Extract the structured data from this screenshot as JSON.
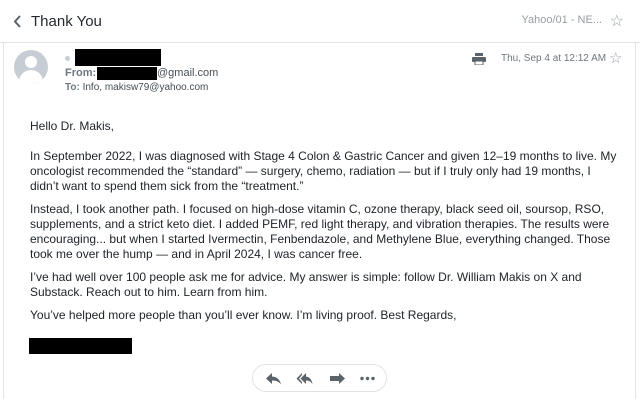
{
  "header": {
    "subject": "Thank You",
    "folder": "Yahoo/01 - NE..."
  },
  "message": {
    "from_label": "From:",
    "from_email_suffix": "@gmail.com",
    "to_label": "To:",
    "to_recipients": "Info,  makisw79@yahoo.com",
    "date": "Thu, Sep 4 at 12:12 AM"
  },
  "body": {
    "greeting": "Hello Dr. Makis,",
    "p1": "In September 2022, I was diagnosed with Stage 4 Colon & Gastric Cancer and given 12–19 months to live. My oncologist recommended the “standard” — surgery, chemo, radiation — but if I truly only had 19 months, I didn’t want to spend them sick from the “treatment.”",
    "p2": "Instead, I took another path. I focused on high-dose vitamin C, ozone therapy, black seed oil, soursop, RSO, supplements, and a strict keto diet. I added PEMF, red light therapy, and vibration therapies. The results were encouraging... but when I started Ivermectin, Fenbendazole, and Methylene Blue, everything changed. Those took me over the hump — and in April 2024, I was cancer free.",
    "p3": "I’ve had well over 100 people ask me for advice. My answer is simple: follow Dr. William Makis on X and Substack. Reach out to him. Learn from him.",
    "p4": "You’ve helped more people than you’ll ever know. I’m living proof. Best Regards,"
  },
  "icons": {
    "back": "chevron-left-icon",
    "star": "star-outline-icon",
    "print": "printer-icon",
    "reply": "reply-icon",
    "reply_all": "reply-all-icon",
    "forward": "forward-icon",
    "more": "more-horizontal-icon"
  },
  "colors": {
    "icon": "#5b636a",
    "muted": "#979ea8",
    "text": "#1d2228",
    "redaction": "#000000"
  }
}
